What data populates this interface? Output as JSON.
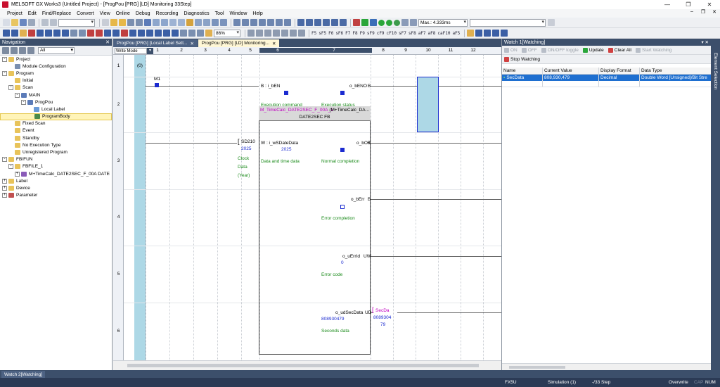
{
  "window": {
    "title": "MELSOFT GX Works3 (Untitled Project) - [ProgPou [PRG] [LD] Monitoring 33Step]"
  },
  "menu": [
    "Project",
    "Edit",
    "Find/Replace",
    "Convert",
    "View",
    "Online",
    "Debug",
    "Recording",
    "Diagnostics",
    "Tool",
    "Window",
    "Help"
  ],
  "toolbar": {
    "zoom": "86%",
    "scan_time": "Max.: 4.333ms"
  },
  "navigation": {
    "title": "Navigation",
    "filter": "All",
    "tree": [
      {
        "label": "Project",
        "level": 0,
        "exp": "-",
        "icon": "folder"
      },
      {
        "label": "Module Configuration",
        "level": 1,
        "exp": "",
        "icon": "module"
      },
      {
        "label": "Program",
        "level": 0,
        "exp": "-",
        "icon": "folder"
      },
      {
        "label": "Initial",
        "level": 1,
        "exp": "",
        "icon": "folder"
      },
      {
        "label": "Scan",
        "level": 1,
        "exp": "-",
        "icon": "folder"
      },
      {
        "label": "MAIN",
        "level": 2,
        "exp": "-",
        "icon": "prog"
      },
      {
        "label": "ProgPou",
        "level": 3,
        "exp": "-",
        "icon": "prog"
      },
      {
        "label": "Local Label",
        "level": 4,
        "exp": "",
        "icon": "label"
      },
      {
        "label": "ProgramBody",
        "level": 4,
        "exp": "",
        "icon": "body",
        "selected": true
      },
      {
        "label": "Fixed Scan",
        "level": 1,
        "exp": "",
        "icon": "folder"
      },
      {
        "label": "Event",
        "level": 1,
        "exp": "",
        "icon": "folder"
      },
      {
        "label": "Standby",
        "level": 1,
        "exp": "",
        "icon": "folder"
      },
      {
        "label": "No Execution Type",
        "level": 1,
        "exp": "",
        "icon": "folder"
      },
      {
        "label": "Unregistered Program",
        "level": 1,
        "exp": "",
        "icon": "folder"
      },
      {
        "label": "FB/FUN",
        "level": 0,
        "exp": "-",
        "icon": "folder"
      },
      {
        "label": "FBFILE_1",
        "level": 1,
        "exp": "-",
        "icon": "folder"
      },
      {
        "label": "M+TimeCalc_DATE2SEC_F_00A DATE",
        "level": 2,
        "exp": "+",
        "icon": "fb"
      },
      {
        "label": "Label",
        "level": 0,
        "exp": "+",
        "icon": "folder"
      },
      {
        "label": "Device",
        "level": 0,
        "exp": "+",
        "icon": "folder"
      },
      {
        "label": "Parameter",
        "level": 0,
        "exp": "+",
        "icon": "param"
      }
    ]
  },
  "tabs": [
    {
      "label": "ProgPou [PRG] [Local Label Sett..."
    },
    {
      "label": "ProgPou [PRG] [LD] Monitoring..."
    }
  ],
  "editor": {
    "write_mode": "Write Mode",
    "columns": [
      "1",
      "2",
      "3",
      "4",
      "5",
      "6",
      "7",
      "8",
      "9",
      "10",
      "11",
      "12"
    ],
    "rows": [
      "1",
      "2",
      "3",
      "4",
      "5",
      "6"
    ],
    "step": "(0)",
    "contact": "M1",
    "clock_device": "SD210",
    "clock_value": "2025",
    "clock_comment": [
      "Clock",
      "Data",
      "(Year)"
    ],
    "fb": {
      "name": "M_TimeCalc_DATE2SEC_F_00A_1",
      "instance": "(M+TimeCalc_DA...",
      "type": "DATE2SEC FB",
      "in_en": "B : i_bEN",
      "in_en_comment": "Execution command",
      "in_date": "W : i_wSDateData",
      "in_date_value": "2025",
      "in_date_comment": "Data and time data",
      "out_end": "o_bENO",
      "out_end_type": "B",
      "out_end_comment": "Execution status",
      "out_ok": "o_bOK",
      "out_ok_type": "B",
      "out_ok_comment": "Normal completion",
      "out_err": "o_bErr",
      "out_err_type": "B",
      "out_err_comment": "Error completion",
      "out_errid": "o_uErrId",
      "out_errid_type": "UW",
      "out_errid_value": "0",
      "out_errid_comment": "Error code",
      "out_sec": "o_udSecData",
      "out_sec_type": "UD",
      "out_sec_value": "808930479",
      "out_sec_comment": "Seconds data"
    },
    "secdata_label": "SecDa",
    "secdata_value_1": "8089304",
    "secdata_value_2": "79"
  },
  "watch": {
    "title": "Watch 1[Watching]",
    "buttons": {
      "on": "ON",
      "off": "OFF",
      "toggle": "ON/OFF toggle",
      "update": "Update",
      "clear": "Clear All",
      "start": "Start Watching",
      "stop": "Stop Watching"
    },
    "columns": [
      "Name",
      "Current Value",
      "Display Format",
      "Data Type"
    ],
    "rows": [
      {
        "name": "SecData",
        "value": "808,930,479",
        "format": "Decimal",
        "type": "Double Word [Unsigned]/Bit Stre"
      }
    ]
  },
  "side_strip": "Element Selection",
  "bottom_tab": "Watch 2[Watching]",
  "status": {
    "cpu": "FX5U",
    "mode": "Simulation (1)",
    "steps": "-/33 Step",
    "overwrite": "Overwrite",
    "cap": "CAP",
    "num": "NUM"
  },
  "colors": {
    "accent": "#3c4f6b",
    "selection": "#1e6fd0",
    "monitor_blue": "#1b2bd0",
    "comment_green": "#1a8a1a",
    "rail_cyan": "#add8e6"
  }
}
